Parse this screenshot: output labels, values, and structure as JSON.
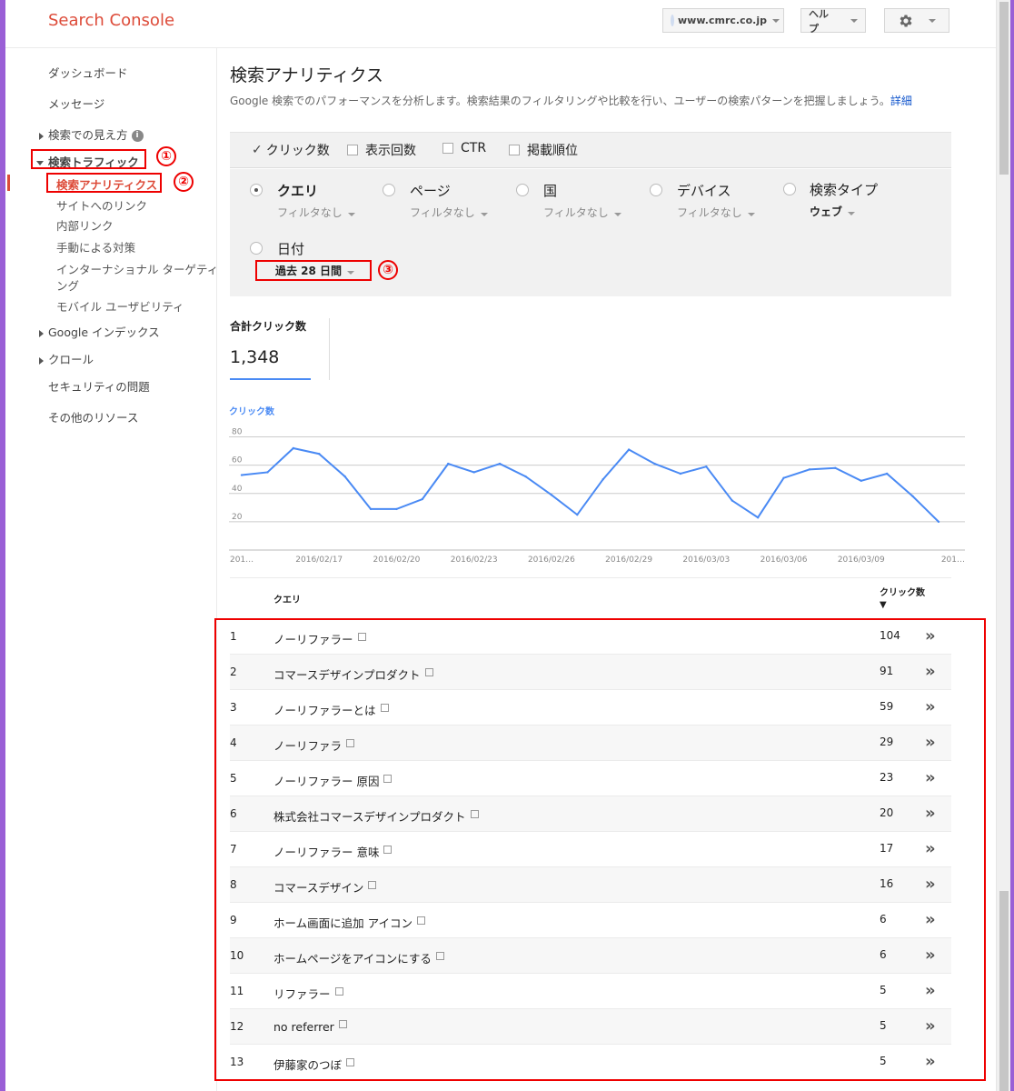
{
  "app": {
    "title": "Search Console"
  },
  "header": {
    "site": "www.cmrc.co.jp",
    "help": "ヘルプ",
    "settings_icon": "gear-icon"
  },
  "sidebar": {
    "items": [
      {
        "label": "ダッシュボード"
      },
      {
        "label": "メッセージ"
      },
      {
        "label": "検索での見え方"
      },
      {
        "label": "検索トラフィック"
      },
      {
        "label": "検索アナリティクス"
      },
      {
        "label": "サイトへのリンク"
      },
      {
        "label": "内部リンク"
      },
      {
        "label": "手動による対策"
      },
      {
        "label": "インターナショナル ターゲティ"
      },
      {
        "label": "ング"
      },
      {
        "label": "モバイル ユーザビリティ"
      },
      {
        "label": "Google インデックス"
      },
      {
        "label": "クロール"
      },
      {
        "label": "セキュリティの問題"
      },
      {
        "label": "その他のリソース"
      }
    ]
  },
  "annotations": [
    "①",
    "②",
    "③"
  ],
  "main": {
    "title": "検索アナリティクス",
    "description": "Google 検索でのパフォーマンスを分析します。検索結果のフィルタリングや比較を行い、ユーザーの検索パターンを把握しましょう。",
    "detail_link": "詳細",
    "metrics": [
      {
        "label": "クリック数",
        "checked": true
      },
      {
        "label": "表示回数",
        "checked": false
      },
      {
        "label": "CTR",
        "checked": false
      },
      {
        "label": "掲載順位",
        "checked": false
      }
    ],
    "groups": [
      {
        "label": "クエリ",
        "filter": "フィルタなし",
        "selected": true
      },
      {
        "label": "ページ",
        "filter": "フィルタなし",
        "selected": false
      },
      {
        "label": "国",
        "filter": "フィルタなし",
        "selected": false
      },
      {
        "label": "デバイス",
        "filter": "フィルタなし",
        "selected": false
      },
      {
        "label": "検索タイプ",
        "filter": "ウェブ",
        "selected": false
      },
      {
        "label": "日付",
        "filter": "過去 28 日間",
        "selected": false
      }
    ],
    "total_label": "合計クリック数",
    "total_value": "1,348"
  },
  "chart_data": {
    "type": "line",
    "title": "クリック数",
    "series": [
      {
        "values": [
          53,
          55,
          72,
          68,
          52,
          29,
          29,
          36,
          61,
          55,
          61,
          52,
          39,
          25,
          50,
          71,
          61,
          54,
          59,
          35,
          23,
          51,
          57,
          58,
          49,
          54,
          38,
          20
        ]
      }
    ],
    "ylim": [
      0,
      90
    ],
    "yticks": [
      "20",
      "40",
      "60",
      "80"
    ],
    "yticks_values": [
      20,
      40,
      60,
      80
    ],
    "xticks": [
      "201…",
      "2016/02/17",
      "2016/02/20",
      "2016/02/23",
      "2016/02/26",
      "2016/02/29",
      "2016/03/03",
      "2016/03/06",
      "2016/03/09",
      "201…"
    ],
    "xtick_indices": [
      0,
      3,
      6,
      9,
      12,
      15,
      18,
      21,
      24,
      27
    ],
    "line_color": "#4a8af4",
    "grid": true
  },
  "table": {
    "headers": {
      "query": "クエリ",
      "clicks": "クリック数"
    },
    "sort_indicator": "▼",
    "rows": [
      {
        "idx": "1",
        "query": "ノーリファラー",
        "clicks": "104"
      },
      {
        "idx": "2",
        "query": "コマースデザインプロダクト",
        "clicks": "91"
      },
      {
        "idx": "3",
        "query": "ノーリファラーとは",
        "clicks": "59"
      },
      {
        "idx": "4",
        "query": "ノーリファラ",
        "clicks": "29"
      },
      {
        "idx": "5",
        "query": "ノーリファラー 原因",
        "clicks": "23"
      },
      {
        "idx": "6",
        "query": "株式会社コマースデザインプロダクト",
        "clicks": "20"
      },
      {
        "idx": "7",
        "query": "ノーリファラー 意味",
        "clicks": "17"
      },
      {
        "idx": "8",
        "query": "コマースデザイン",
        "clicks": "16"
      },
      {
        "idx": "9",
        "query": "ホーム画面に追加 アイコン",
        "clicks": "6"
      },
      {
        "idx": "10",
        "query": "ホームページをアイコンにする",
        "clicks": "6"
      },
      {
        "idx": "11",
        "query": "リファラー",
        "clicks": "5"
      },
      {
        "idx": "12",
        "query": "no referrer",
        "clicks": "5"
      },
      {
        "idx": "13",
        "query": "伊藤家のつぼ",
        "clicks": "5"
      }
    ]
  }
}
